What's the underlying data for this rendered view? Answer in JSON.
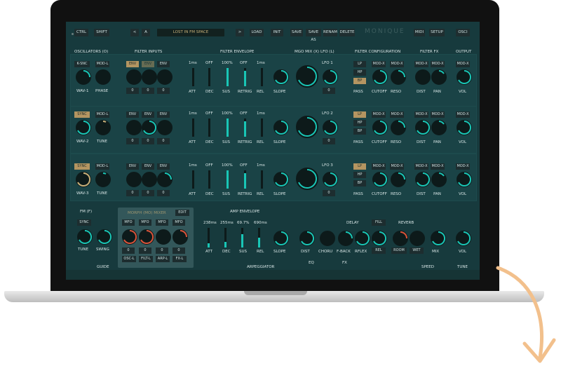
{
  "topbar": {
    "ctrl": "CTRL",
    "shift": "SHIFT",
    "prev": "<",
    "a": "A",
    "program": "LOST IN FM SPACE",
    "next": ">",
    "load": "LOAD",
    "init": "INIT",
    "save": "SAVE",
    "save_as": "SAVE AS",
    "rename": "RENAM",
    "delete": "DELETE",
    "brand": "MONIQUE",
    "midi": "MIDI",
    "setup": "SETUP",
    "osci": "OSCI"
  },
  "headers": {
    "oscillators": "OSCILLATORS (O)",
    "filter_inputs": "FILTER INPUTS",
    "filter_envelope": "FILTER ENVELOPE",
    "mgo_mix": "MGO MIX (X)",
    "lfo": "LFO (L)",
    "filter_config": "FILTER CONFIGURATION",
    "filter_fx": "FILTER FX",
    "output": "OUTPUT",
    "fm": "FM (F)",
    "morph": "MORPH (MO) MIXER",
    "amp_envelope": "AMP ENVELOPE",
    "delay": "DELAY",
    "reverb": "REVERB",
    "eq": "EQ",
    "fx": "FX",
    "arpeggiator": "ARPEGGIATOR",
    "guide": "GUIDE",
    "speed": "SPEED",
    "tune": "TUNE"
  },
  "osc": [
    {
      "top_left": "K-SNC",
      "top_right": "MOD-L",
      "bottom_left": "WAV-1",
      "bottom_right": "PHASE"
    },
    {
      "top_left": "SYNC",
      "top_right": "MOD-L",
      "bottom_left": "WAV-2",
      "bottom_right": "TUNE"
    },
    {
      "top_left": "SYNC",
      "top_right": "MOD-L",
      "bottom_left": "WAV-3",
      "bottom_right": "TUNE"
    }
  ],
  "filter_inputs": {
    "env": "ENV",
    "zero": "0"
  },
  "env_values": {
    "att": "1ms",
    "dec": "OFF",
    "sus": "100%",
    "retrig": "OFF",
    "rel": "1ms"
  },
  "env_labels": {
    "att": "ATT",
    "dec": "DEC",
    "sus": "SUS",
    "retrig": "RETRIG",
    "rel": "REL",
    "slope": "SLOPE"
  },
  "lfo": [
    "LFO 1",
    "LFO 2",
    "LFO 3"
  ],
  "filter_config": {
    "lp": "LP",
    "hp": "HP",
    "bp": "BP",
    "pass": "PASS",
    "modx": "MOD-X",
    "cutoff": "CUTOFF",
    "reso": "RESO"
  },
  "filter_fx": {
    "modx": "MOD-X",
    "dist": "DIST",
    "pan": "PAN"
  },
  "output": {
    "modx": "MOD-X",
    "vol": "VOL"
  },
  "fm": {
    "sync": "SYNC",
    "tune": "TUNE",
    "swing": "SWING"
  },
  "morph": {
    "edit": "EDIT",
    "mfo": "MFO",
    "oscl": "OSC-L",
    "filtl": "FILT-L",
    "arpl": "ARP-L",
    "fxl": "FX-L"
  },
  "amp": {
    "att_val": "238ms",
    "dec_val": "255ms",
    "sus_val": "69.7%",
    "rel_val": "690ms",
    "att": "ATT",
    "dec": "DEC",
    "sus": "SUS",
    "rel": "REL",
    "slope": "SLOPE"
  },
  "fxsec": {
    "dist": "DIST",
    "chorus": "CHORU",
    "fback": "F-BACK",
    "rflex": "RFLEX",
    "fill": "FILL",
    "rel": "REL",
    "room": "ROOM",
    "wet": "WET",
    "mix": "MIX",
    "vol": "VOL"
  }
}
